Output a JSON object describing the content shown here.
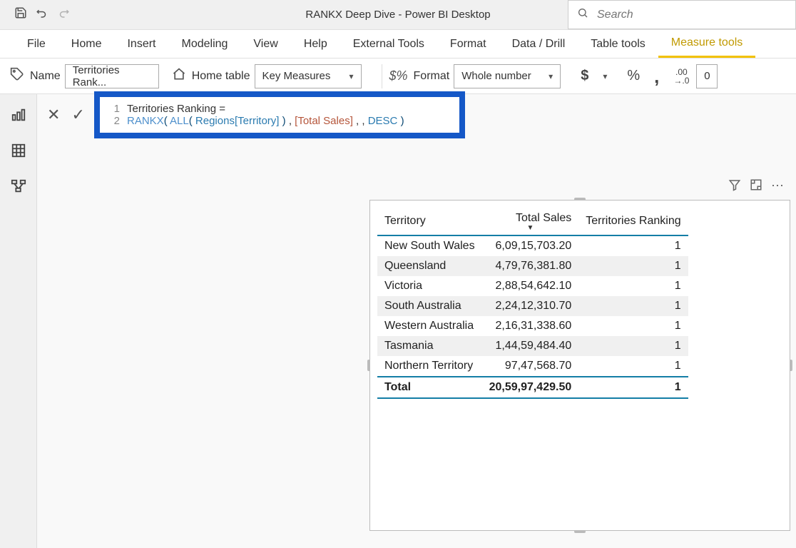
{
  "titlebar": {
    "title": "RANKX Deep Dive - Power BI Desktop",
    "search_placeholder": "Search"
  },
  "menubar": {
    "items": [
      "File",
      "Home",
      "Insert",
      "Modeling",
      "View",
      "Help",
      "External Tools",
      "Format",
      "Data / Drill",
      "Table tools",
      "Measure tools"
    ],
    "active_index": 10
  },
  "toolbar": {
    "name_label": "Name",
    "name_value": "Territories Rank...",
    "home_table_label": "Home table",
    "home_table_value": "Key Measures",
    "format_label": "Format",
    "format_value": "Whole number",
    "currency_symbol": "$",
    "percent_symbol": "%",
    "comma_symbol": ",",
    "dec_shift_symbol": ".00 →.0",
    "decimals_value": "0"
  },
  "formula": {
    "line1": "Territories Ranking =",
    "line2_fn": "RANKX",
    "line2_all": "ALL",
    "line2_col_table": "Regions",
    "line2_col_field": "[Territory]",
    "line2_measure": "[Total Sales]",
    "line2_order": "DESC"
  },
  "table": {
    "columns": [
      "Territory",
      "Total Sales",
      "Territories Ranking"
    ],
    "sorted_col_index": 1,
    "sorted_dir": "desc",
    "rows": [
      [
        "New South Wales",
        "6,09,15,703.20",
        "1"
      ],
      [
        "Queensland",
        "4,79,76,381.80",
        "1"
      ],
      [
        "Victoria",
        "2,88,54,642.10",
        "1"
      ],
      [
        "South Australia",
        "2,24,12,310.70",
        "1"
      ],
      [
        "Western Australia",
        "2,16,31,338.60",
        "1"
      ],
      [
        "Tasmania",
        "1,44,59,484.40",
        "1"
      ],
      [
        "Northern Territory",
        "97,47,568.70",
        "1"
      ]
    ],
    "total_row": [
      "Total",
      "20,59,97,429.50",
      "1"
    ]
  },
  "chart_data": {
    "type": "table",
    "title": "",
    "columns": [
      "Territory",
      "Total Sales",
      "Territories Ranking"
    ],
    "rows": [
      {
        "Territory": "New South Wales",
        "Total Sales": 60915703.2,
        "Territories Ranking": 1
      },
      {
        "Territory": "Queensland",
        "Total Sales": 47976381.8,
        "Territories Ranking": 1
      },
      {
        "Territory": "Victoria",
        "Total Sales": 28854642.1,
        "Territories Ranking": 1
      },
      {
        "Territory": "South Australia",
        "Total Sales": 22412310.7,
        "Territories Ranking": 1
      },
      {
        "Territory": "Western Australia",
        "Total Sales": 21631338.6,
        "Territories Ranking": 1
      },
      {
        "Territory": "Tasmania",
        "Total Sales": 14459484.4,
        "Territories Ranking": 1
      },
      {
        "Territory": "Northern Territory",
        "Total Sales": 9747568.7,
        "Territories Ranking": 1
      }
    ],
    "total": {
      "Territory": "Total",
      "Total Sales": 205997429.5,
      "Territories Ranking": 1
    }
  }
}
